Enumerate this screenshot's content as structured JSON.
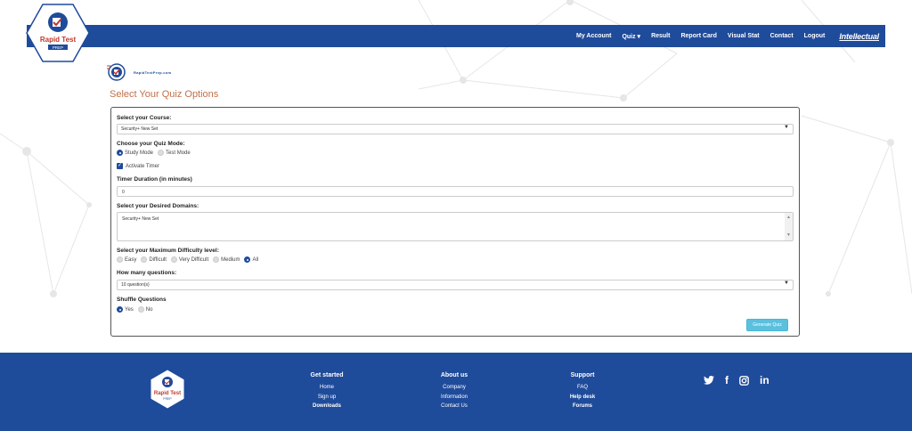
{
  "header": {
    "logo_text": "Rapid Test",
    "logo_sub": "PREP",
    "nav": [
      "My Account",
      "Quiz ▾",
      "Result",
      "Report Card",
      "Visual Stat",
      "Contact",
      "Logout"
    ],
    "brand": "Intellectual"
  },
  "mini_logo_text": "RapidTestPrep.com",
  "page_title": "Select Your Quiz Options",
  "form": {
    "course_label": "Select your Course:",
    "course_value": "Security+ New Set",
    "mode_label": "Choose your Quiz Mode:",
    "mode_options": [
      "Study Mode",
      "Test Mode"
    ],
    "timer_checkbox": "Activate Timer",
    "timer_label": "Timer Duration (in minutes)",
    "timer_value": "0",
    "domains_label": "Select your Desired Domains:",
    "domains_value": "Security+ New Set",
    "difficulty_label": "Select your Maximum Difficulty level:",
    "difficulty_options": [
      "Easy",
      "Difficult",
      "Very Difficult",
      "Medium",
      "All"
    ],
    "questions_label": "How many questions:",
    "questions_value": "10 question(s)",
    "shuffle_label": "Shuffle Questions",
    "shuffle_options": [
      "Yes",
      "No"
    ],
    "generate_button": "Generate Quiz"
  },
  "footer": {
    "col1": {
      "title": "Get started",
      "links": [
        "Home",
        "Sign up",
        "Downloads"
      ]
    },
    "col2": {
      "title": "About us",
      "links": [
        "Company",
        "Information",
        "Contact Us"
      ]
    },
    "col3": {
      "title": "Support",
      "links": [
        "FAQ",
        "Help desk",
        "Forums"
      ]
    },
    "social": {
      "twitter": "twitter-icon",
      "facebook": "f",
      "instagram": "instagram-icon",
      "linkedin": "in"
    }
  },
  "colors": {
    "primary": "#1f4b9b",
    "accent": "#5bc0de",
    "title": "#c0714a"
  }
}
